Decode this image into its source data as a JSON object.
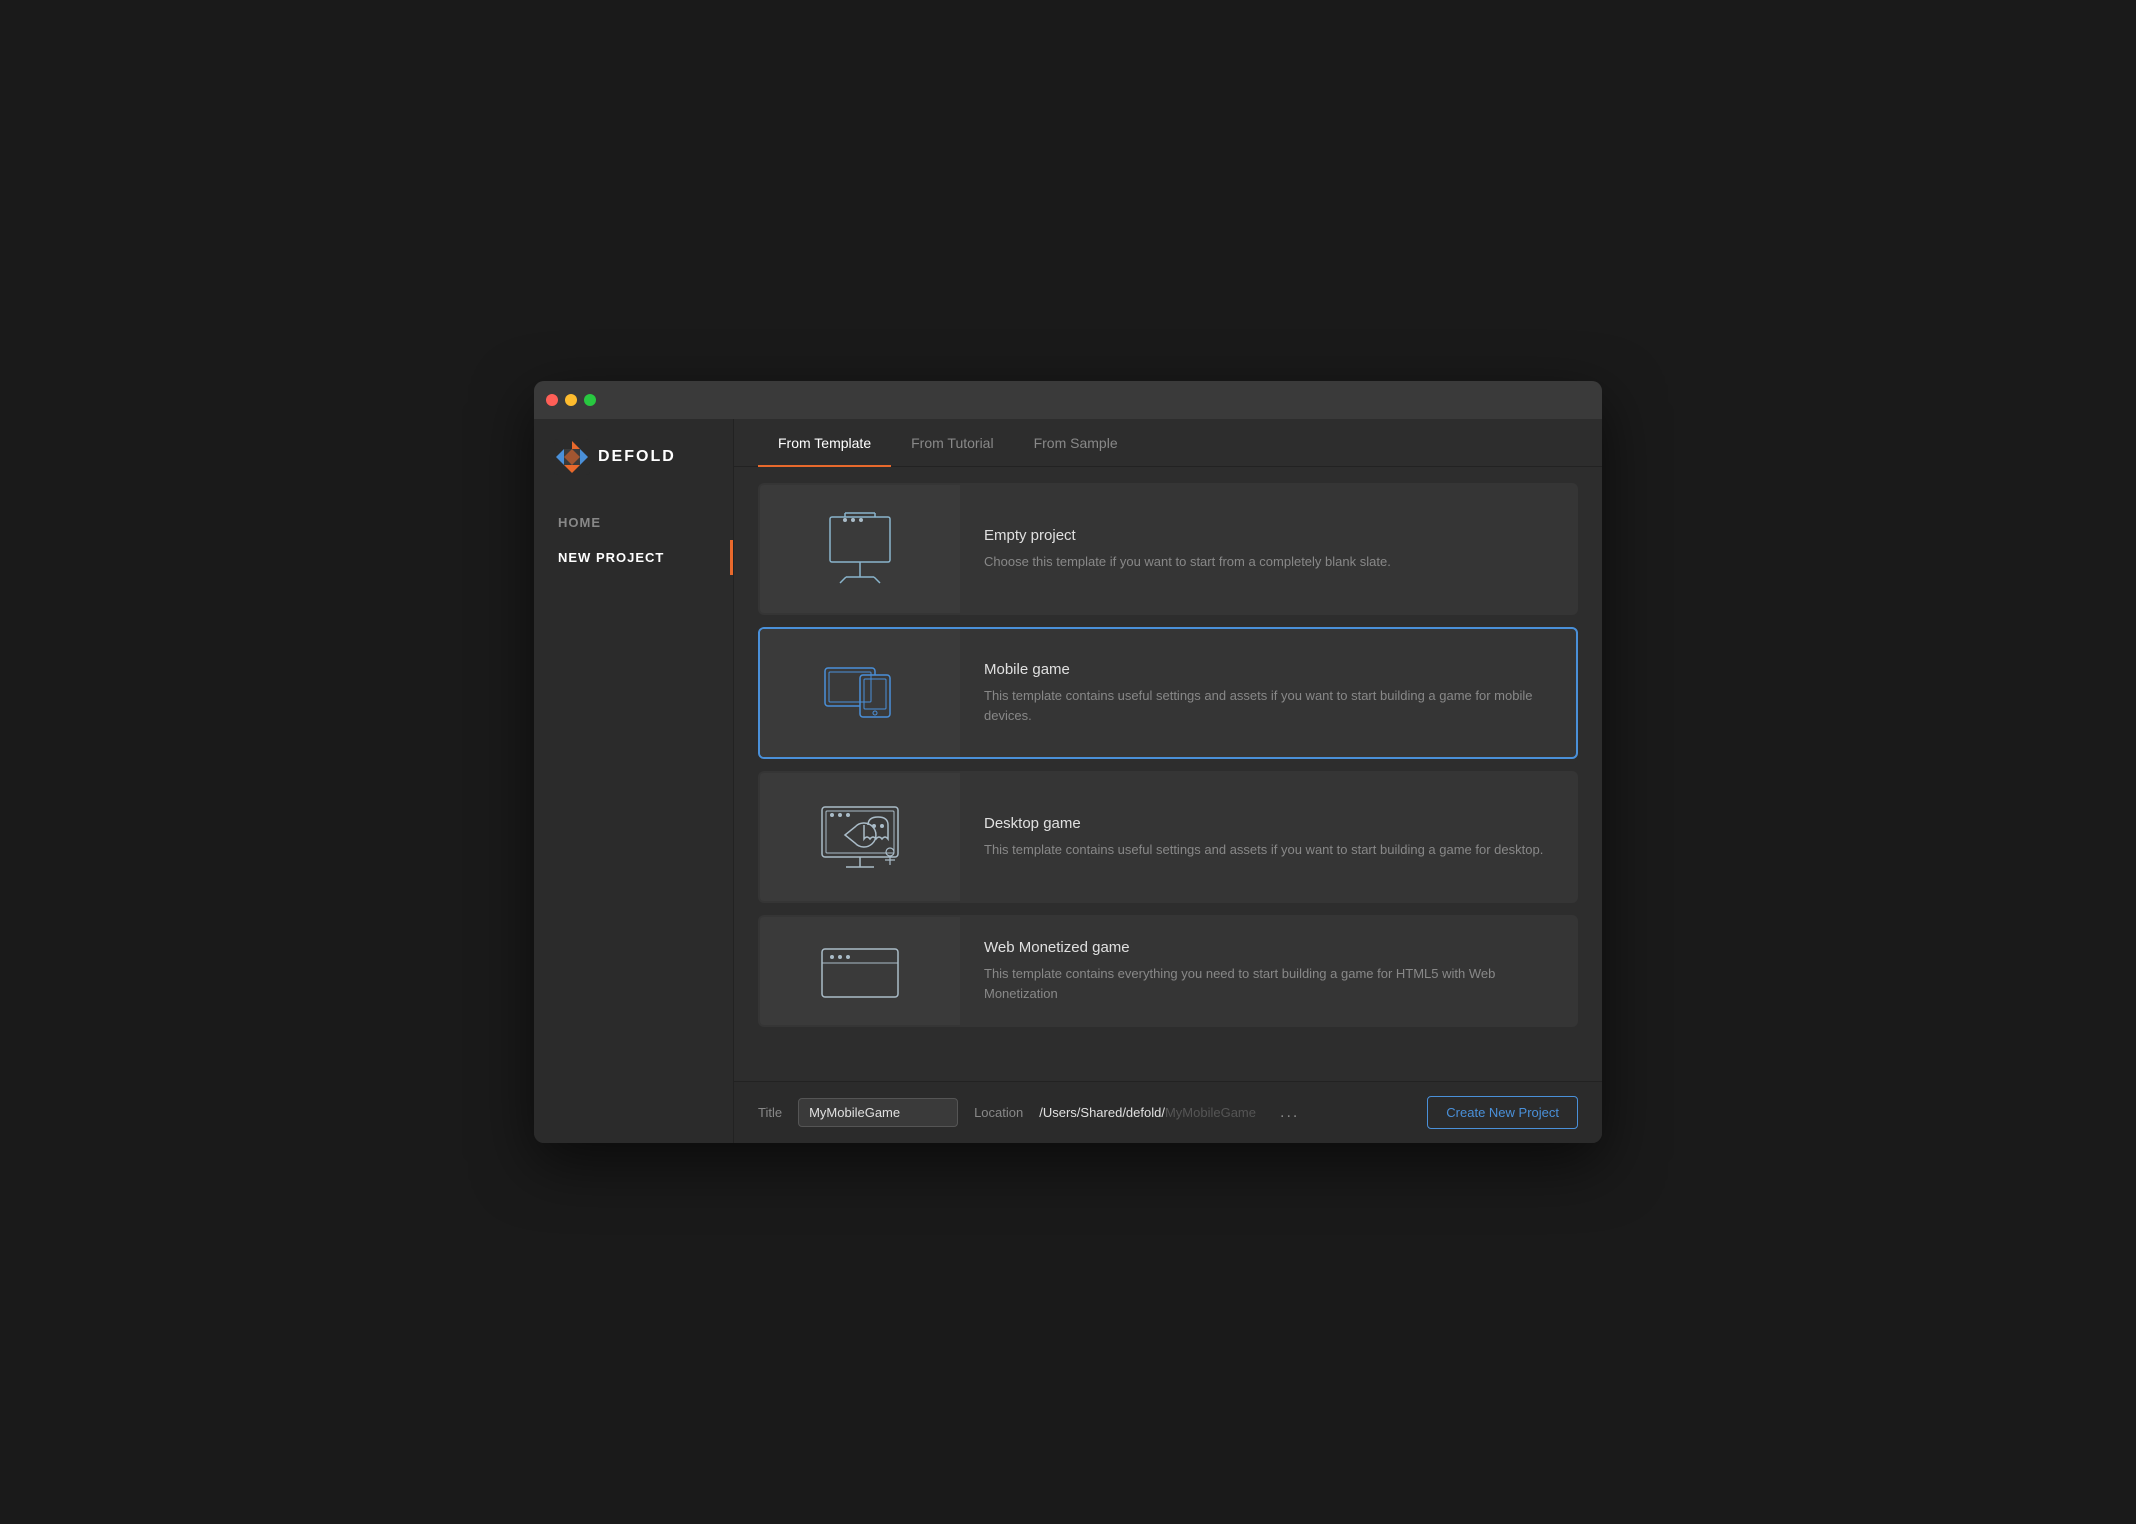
{
  "window": {
    "title": "Defold"
  },
  "sidebar": {
    "logo_text": "DEFOLD",
    "items": [
      {
        "id": "home",
        "label": "HOME",
        "active": false
      },
      {
        "id": "new-project",
        "label": "NEW PROJECT",
        "active": true
      }
    ]
  },
  "tabs": [
    {
      "id": "from-template",
      "label": "From Template",
      "active": true
    },
    {
      "id": "from-tutorial",
      "label": "From Tutorial",
      "active": false
    },
    {
      "id": "from-sample",
      "label": "From Sample",
      "active": false
    }
  ],
  "templates": [
    {
      "id": "empty",
      "name": "Empty project",
      "description": "Choose this template if you want to start from a completely blank slate.",
      "selected": false,
      "icon": "easel"
    },
    {
      "id": "mobile",
      "name": "Mobile game",
      "description": "This template contains useful settings and assets if you want to start building a game for mobile devices.",
      "selected": true,
      "icon": "mobile"
    },
    {
      "id": "desktop",
      "name": "Desktop game",
      "description": "This template contains useful settings and assets if you want to start building a game for desktop.",
      "selected": false,
      "icon": "desktop"
    },
    {
      "id": "web",
      "name": "Web Monetized game",
      "description": "This template contains everything you need to start building a game for HTML5 with Web Monetization",
      "selected": false,
      "icon": "web"
    }
  ],
  "bottom_bar": {
    "title_label": "Title",
    "title_value": "MyMobileGame",
    "location_label": "Location",
    "location_path": "/Users/Shared/defold/",
    "location_suffix": "MyMobileGame",
    "more_label": "...",
    "create_label": "Create New Project"
  }
}
